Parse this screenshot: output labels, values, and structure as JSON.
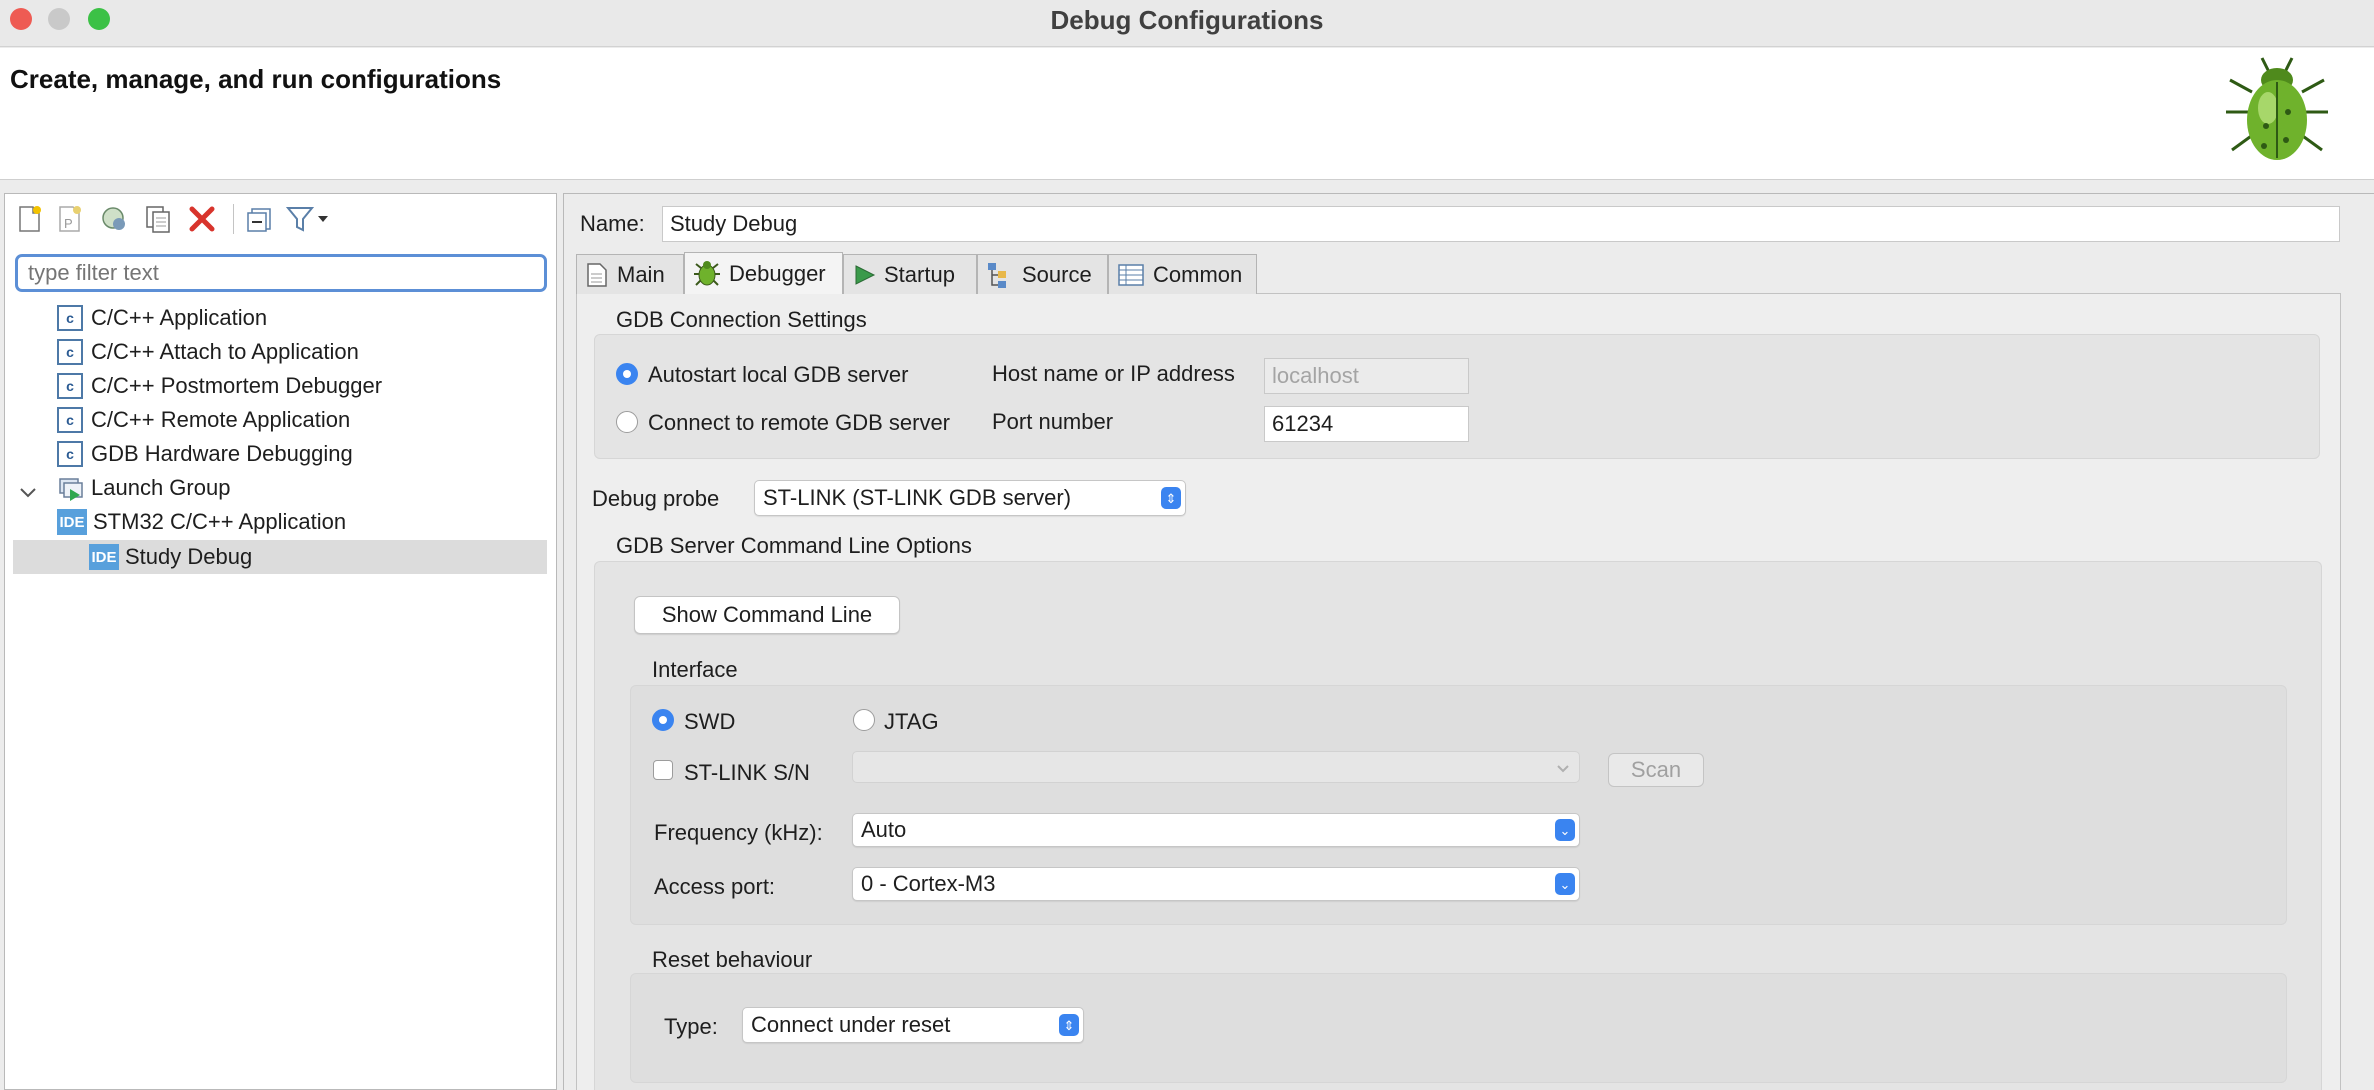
{
  "window": {
    "title": "Debug Configurations"
  },
  "header": {
    "title": "Create, manage, and run configurations"
  },
  "toolbar": {
    "icons": [
      "new-config-icon",
      "new-prototype-icon",
      "export-icon",
      "duplicate-icon",
      "delete-icon",
      "collapse-all-icon",
      "filter-icon"
    ]
  },
  "filter": {
    "placeholder": "type filter text"
  },
  "tree": {
    "items": [
      {
        "label": "C/C++ Application"
      },
      {
        "label": "C/C++ Attach to Application"
      },
      {
        "label": "C/C++ Postmortem Debugger"
      },
      {
        "label": "C/C++ Remote Application"
      },
      {
        "label": "GDB Hardware Debugging"
      },
      {
        "label": "Launch Group"
      },
      {
        "label": "STM32 C/C++ Application"
      },
      {
        "label": "Study Debug"
      }
    ],
    "c_icon_glyph": "c",
    "ide_icon_glyph": "IDE"
  },
  "config": {
    "name_label": "Name:",
    "name_value": "Study Debug"
  },
  "tabs": [
    {
      "label": "Main"
    },
    {
      "label": "Debugger"
    },
    {
      "label": "Startup"
    },
    {
      "label": "Source"
    },
    {
      "label": "Common"
    }
  ],
  "gdb_connection": {
    "title": "GDB Connection Settings",
    "autostart_label": "Autostart local GDB server",
    "remote_label": "Connect to remote GDB server",
    "host_label": "Host name or IP address",
    "host_value": "localhost",
    "port_label": "Port number",
    "port_value": "61234"
  },
  "debug_probe": {
    "label": "Debug probe",
    "value": "ST-LINK (ST-LINK GDB server)"
  },
  "server_options": {
    "title": "GDB Server Command Line Options",
    "show_cmd_button": "Show Command Line",
    "interface_title": "Interface",
    "swd_label": "SWD",
    "jtag_label": "JTAG",
    "stlink_sn_label": "ST-LINK S/N",
    "scan_button": "Scan",
    "frequency_label": "Frequency (kHz):",
    "frequency_value": "Auto",
    "access_port_label": "Access port:",
    "access_port_value": "0 - Cortex-M3"
  },
  "reset": {
    "title": "Reset behaviour",
    "type_label": "Type:",
    "type_value": "Connect under reset"
  },
  "colors": {
    "accent": "#3a84f0",
    "close": "#ee5b53",
    "minimize": "#c9c9c9",
    "maximize": "#3cc146"
  }
}
